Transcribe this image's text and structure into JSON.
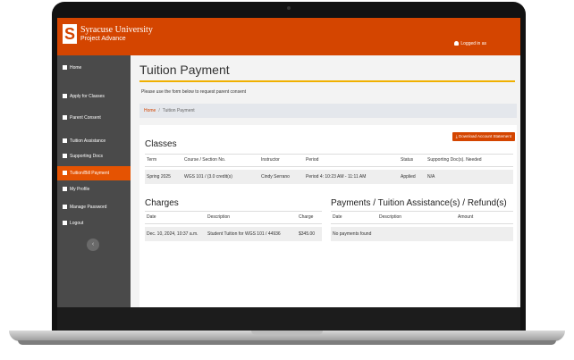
{
  "brand": {
    "name": "Syracuse University",
    "subname": "Project Advance",
    "logo_letter": "S"
  },
  "header": {
    "logged_in": "Logged in as"
  },
  "sidebar": {
    "items": [
      {
        "label": "Home",
        "active": false
      },
      {
        "label": "Apply for Classes",
        "active": false
      },
      {
        "label": "Parent Consent",
        "active": false
      },
      {
        "label": "Tuition Assistance",
        "active": false
      },
      {
        "label": "Supporting Docs",
        "active": false
      },
      {
        "label": "Tuition/Bill Payment",
        "active": true
      },
      {
        "label": "My Profile",
        "active": false
      },
      {
        "label": "Manage Password",
        "active": false
      },
      {
        "label": "Logout",
        "active": false
      }
    ],
    "collapse_glyph": "‹"
  },
  "page": {
    "title": "Tuition Payment",
    "intro": "Please use the form below to request parent consent",
    "breadcrumb": {
      "home": "Home",
      "separator": "/",
      "current": "Tuition Payment"
    }
  },
  "actions": {
    "download": "Download Account Statement"
  },
  "classes": {
    "heading": "Classes",
    "columns": [
      "Term",
      "Course / Section No.",
      "Instructor",
      "Period",
      "Status",
      "Supporting Doc(s). Needed"
    ],
    "rows": [
      {
        "term": "Spring 2025",
        "course": "WGS 101 / (3.0 credit(s)",
        "instructor": "Cindy Serrano",
        "period": "Period 4: 10:23 AM - 11:11 AM",
        "status": "Applied",
        "docs": "N/A"
      }
    ]
  },
  "charges": {
    "heading": "Charges",
    "columns": [
      "Date",
      "Description",
      "Charge"
    ],
    "rows": [
      {
        "date": "Dec. 10, 2024, 10:37 a.m.",
        "description": "Student Tuition for WGS 101 / 44936",
        "charge": "$345.00"
      }
    ]
  },
  "payments": {
    "heading": "Payments / Tuition Assistance(s) / Refund(s)",
    "columns": [
      "Date",
      "Description",
      "Amount"
    ],
    "empty": "No payments found"
  },
  "colors": {
    "brand_orange": "#d44500",
    "active_nav": "#e55302",
    "sidebar": "#4a4a4a",
    "title_rule": "#f0b000"
  }
}
